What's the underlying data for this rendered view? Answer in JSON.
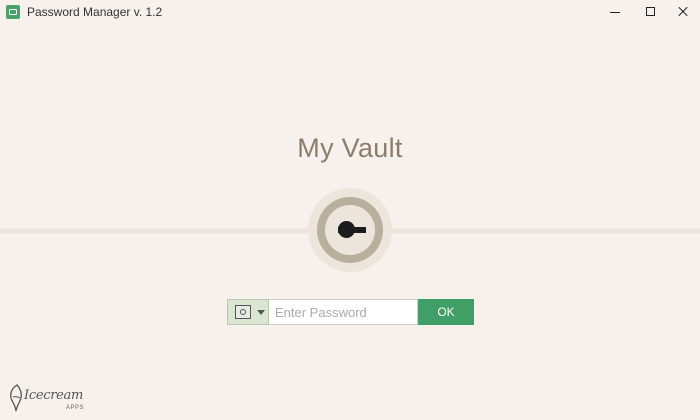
{
  "window": {
    "title": "Password Manager v. 1.2",
    "icon": "app-icon",
    "controls": [
      "minimize-icon",
      "maximize-icon",
      "close-icon"
    ]
  },
  "vault": {
    "title": "My Vault",
    "lock_icon": "keyhole-lock-icon"
  },
  "auth": {
    "key_type_icon": "safe-icon",
    "password_placeholder": "Enter Password",
    "password_value": "",
    "ok_label": "OK"
  },
  "brand": {
    "name": "Icecream",
    "sub": "APPS"
  },
  "colors": {
    "background": "#f6f1ec",
    "accent": "#3f9f67",
    "title_text": "#8c7d6b",
    "lock_ring": "#b9af9d"
  }
}
